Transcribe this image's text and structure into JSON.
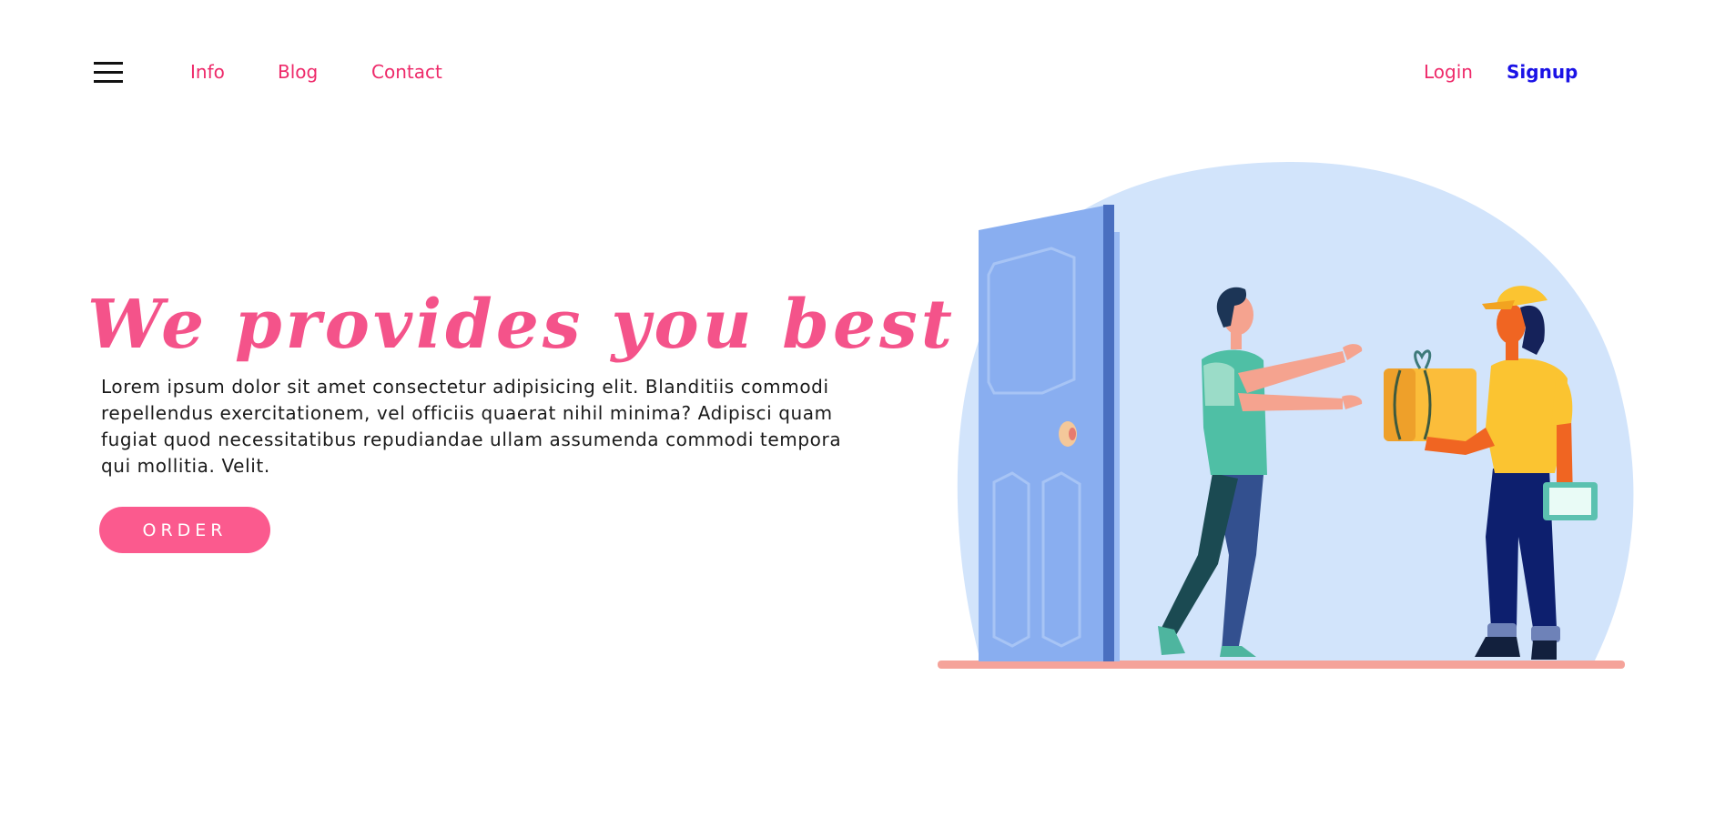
{
  "nav": {
    "menu_icon": "hamburger-menu-icon",
    "links": [
      "Info",
      "Blog",
      "Contact"
    ],
    "login_label": "Login",
    "signup_label": "Signup"
  },
  "hero": {
    "title": "We provides you best",
    "paragraph": "Lorem ipsum dolor sit amet consectetur adipisicing elit. Blanditiis commodi repellendus exercitationem, vel officiis quaerat nihil minima? Adipisci quam fugiat quod necessitatibus repudiandae ullam assumenda commodi tempora qui mollitia. Velit.",
    "order_label": "ORDER"
  },
  "illustration": {
    "name": "delivery-illustration",
    "description_icon": "courier-delivering-package-to-customer-at-door"
  },
  "colors": {
    "accent_pink": "#f4538a",
    "link_pink": "#ee2a6a",
    "signup_blue": "#1a12e6",
    "button_pink": "#fb5a8e",
    "blob_blue": "#d2e4fb"
  }
}
